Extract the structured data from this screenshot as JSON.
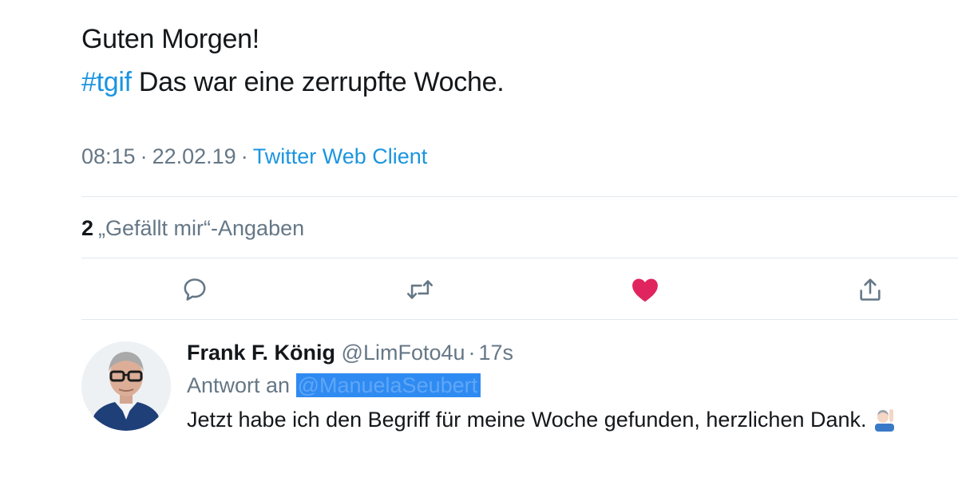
{
  "tweet": {
    "line1": "Guten Morgen!",
    "hashtag": "#tgif",
    "line2_rest": " Das war eine zerrupfte Woche.",
    "time": "08:15",
    "date": "22.02.19",
    "separator": "·",
    "client": "Twitter Web Client"
  },
  "engagement": {
    "likes_count": "2",
    "likes_label": "„Gefällt mir“-Angaben"
  },
  "actions": [
    {
      "icon": "reply-icon"
    },
    {
      "icon": "retweet-icon"
    },
    {
      "icon": "heart-filled-icon",
      "color": "#e0245e"
    },
    {
      "icon": "share-icon"
    }
  ],
  "reply": {
    "name": "Frank F. König",
    "handle": "@LimFoto4u",
    "dot": "·",
    "age": "17s",
    "reply_prefix": "Antwort an ",
    "reply_mention": "@ManuelaSeubert",
    "text": "Jetzt habe ich den Begriff für meine Woche gefunden, herzlichen Dank."
  },
  "colors": {
    "link": "#1b95e0",
    "muted": "#657786",
    "text": "#14171a",
    "divider": "#e1e8ed",
    "like": "#e0245e",
    "highlight": "#2f8bf2"
  }
}
